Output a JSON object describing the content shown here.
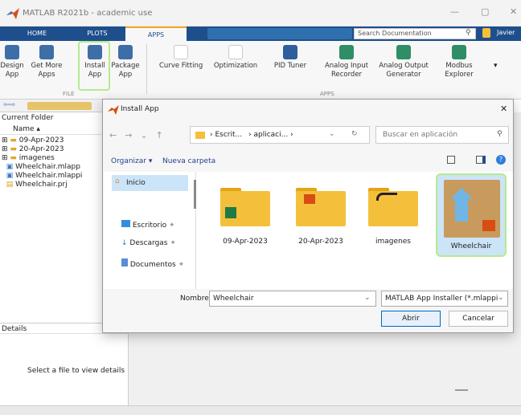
{
  "window": {
    "title": "MATLAB R2021b - academic use",
    "min": "—",
    "max": "▢",
    "close": "✕"
  },
  "tabs": {
    "home": "HOME",
    "plots": "PLOTS",
    "apps": "APPS"
  },
  "search": {
    "placeholder": "Search Documentation",
    "user": "Javier"
  },
  "ribbon": {
    "design": "Design\nApp",
    "getmore": "Get More\nApps",
    "install": "Install\nApp",
    "package": "Package\nApp",
    "file_section": "FILE",
    "apps_section": "APPS",
    "apps": [
      "Curve Fitting",
      "Optimization",
      "PID Tuner",
      "Analog Input\nRecorder",
      "Analog Output\nGenerator",
      "Modbus\nExplorer"
    ]
  },
  "current_folder": {
    "title": "Current Folder",
    "name_header": "Name ▴",
    "items": [
      "09-Apr-2023",
      "20-Apr-2023",
      "imagenes",
      "Wheelchair.mlapp",
      "Wheelchair.mlappi",
      "Wheelchair.prj"
    ]
  },
  "details": {
    "title": "Details",
    "message": "Select a file to view details"
  },
  "dialog": {
    "title": "Install App",
    "breadcrumb": [
      "Escrit...",
      "aplicaci..."
    ],
    "search_placeholder": "Buscar en aplicación",
    "organize": "Organizar ▾",
    "new_folder": "Nueva carpeta",
    "nav": {
      "home": "Inicio",
      "desktop": "Escritorio",
      "downloads": "Descargas",
      "documents": "Documentos"
    },
    "files": [
      "09-Apr-2023",
      "20-Apr-2023",
      "imagenes",
      "Wheelchair"
    ],
    "name_label": "Nombre:",
    "name_value": "Wheelchair",
    "filter": "MATLAB App Installer (*.mlappi",
    "open": "Abrir",
    "cancel": "Cancelar"
  },
  "colors": {
    "ribbon_blue": "#1e4f8c",
    "folder": "#f4c03c",
    "highlight": "#b6ea8e",
    "accent": "#0067c0"
  }
}
